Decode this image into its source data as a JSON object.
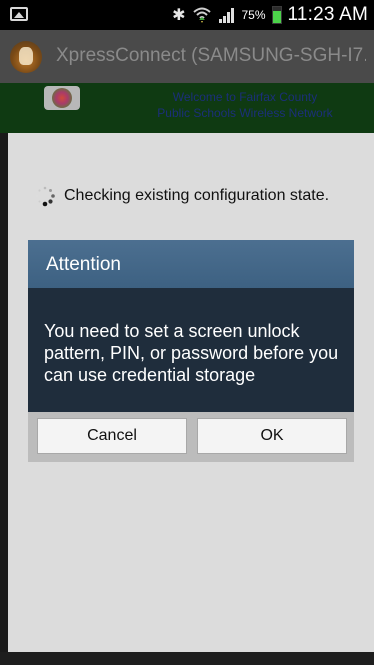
{
  "status_bar": {
    "battery_percent": "75%",
    "battery_level": 0.75,
    "time": "11:23 AM",
    "icons": [
      "gallery-icon",
      "bluetooth-icon",
      "wifi-icon",
      "signal-icon",
      "battery-icon"
    ]
  },
  "app_bar": {
    "title": "XpressConnect  (SAMSUNG-SGH-I7..."
  },
  "banner": {
    "line1": "Welcome to Fairfax County",
    "line2": "Public Schools Wireless Network"
  },
  "status": {
    "message": "Checking existing configuration state."
  },
  "dialog": {
    "title": "Attention",
    "message": "You need to set a screen unlock pattern, PIN, or password before you can use credential storage",
    "cancel_label": "Cancel",
    "ok_label": "OK"
  },
  "colors": {
    "dialog_header": "#456987",
    "dialog_body": "#1f2d3c",
    "banner_bg": "#0f3a12",
    "app_bar": "#4a4a4a",
    "battery_fill": "#4cd34a"
  }
}
